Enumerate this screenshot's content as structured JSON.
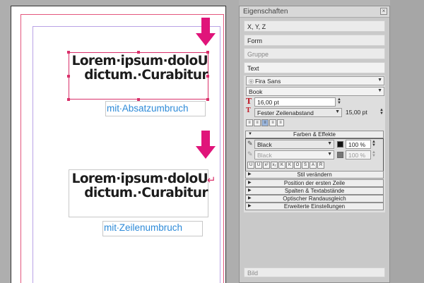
{
  "canvas": {
    "frame1_lines": [
      "Lorem∙ipsum∙doloU",
      "dictum.∙Curabitur"
    ],
    "frame1_caption": "mit∙Absatzumbruch",
    "frame2_lines": [
      "Lorem∙ipsum∙doloU",
      "dictum.∙Curabitur"
    ],
    "frame2_caption": "mit∙Zeilenumbruch",
    "caption_color": "#2d8ad8",
    "arrow_color": "#e0147a",
    "selection_color": "#d9306a"
  },
  "panel": {
    "title": "Eigenschaften",
    "close_icon": "close-icon",
    "sections": {
      "xyz": "X, Y, Z",
      "form": "Form",
      "gruppe": "Gruppe",
      "text": "Text",
      "bild": "Bild"
    },
    "text": {
      "font": "Fira Sans",
      "style": "Book",
      "size": "16,00 pt",
      "linespacing_mode": "Fester Zeilenabstand",
      "linespacing_value": "15,00 pt",
      "effects_header": "Farben & Effekte",
      "stroke_color": "Black",
      "stroke_shade": "100 %",
      "fill_color": "Black",
      "fill_shade": "100 %",
      "format_buttons": [
        "U",
        "U",
        "x²",
        "x₂",
        "K",
        "K",
        "O",
        "S",
        "A",
        "R"
      ],
      "collapsed": [
        "Stil verändern",
        "Position der ersten Zeile",
        "Spalten & Textabstände",
        "Optischer Randausgleich",
        "Erweiterte Einstellungen"
      ]
    }
  }
}
